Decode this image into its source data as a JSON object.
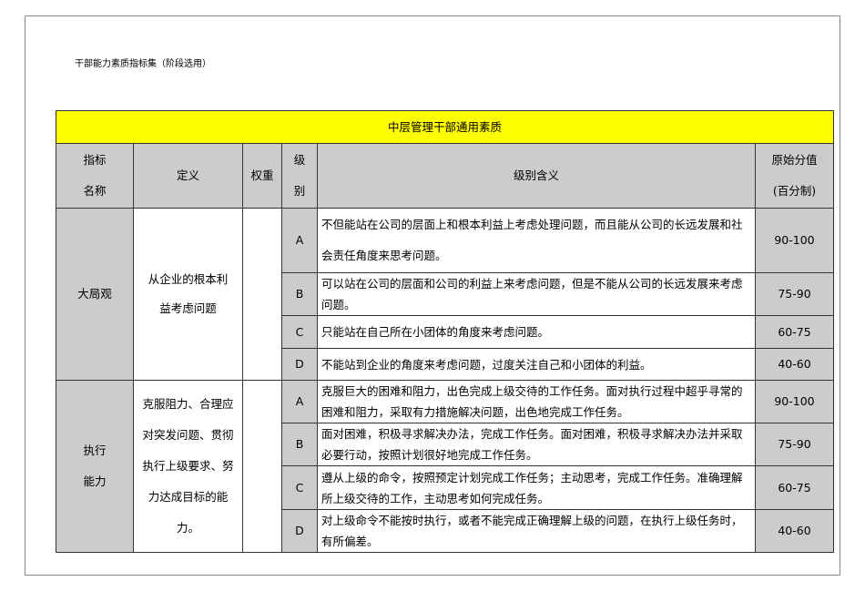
{
  "doc_title": "干部能力素质指标集（阶段选用）",
  "table_title": "中层管理干部通用素质",
  "headers": {
    "name_1": "指标",
    "name_2": "名称",
    "definition": "定义",
    "weight": "权重",
    "level_1": "级",
    "level_2": "别",
    "meaning": "级别含义",
    "score_1": "原始分值",
    "score_2": "(百分制)"
  },
  "groups": [
    {
      "name": "大局观",
      "definition": "从企业的根本利益考虑问题",
      "weight": "",
      "levels": [
        {
          "level": "A",
          "meaning": "不但能站在公司的层面上和根本利益上考虑处理问题，而且能从公司的长远发展和社会责任角度来思考问题。",
          "score": "90-100"
        },
        {
          "level": "B",
          "meaning": "可以站在公司的层面和公司的利益上来考虑问题，但是不能从公司的长远发展来考虑问题。",
          "score": "75-90"
        },
        {
          "level": "C",
          "meaning": "只能站在自己所在小团体的角度来考虑问题。",
          "score": "60-75"
        },
        {
          "level": "D",
          "meaning": "不能站到企业的角度来考虑问题，过度关注自己和小团体的利益。",
          "score": "40-60"
        }
      ]
    },
    {
      "name": "执行能力",
      "definition": "克服阻力、合理应对突发问题、贯彻执行上级要求、努力达成目标的能力。",
      "weight": "",
      "levels": [
        {
          "level": "A",
          "meaning": "克服巨大的困难和阻力，出色完成上级交待的工作任务。面对执行过程中超乎寻常的困难和阻力，采取有力措施解决问题，出色地完成工作任务。",
          "score": "90-100"
        },
        {
          "level": "B",
          "meaning": "面对困难，积极寻求解决办法，完成工作任务。面对困难，积极寻求解决办法并采取必要行动，按照计划很好地完成工作任务。",
          "score": "75-90"
        },
        {
          "level": "C",
          "meaning": "遵从上级的命令，按照预定计划完成工作任务；主动思考，完成工作任务。准确理解所上级交待的工作，主动思考如何完成任务。",
          "score": "60-75"
        },
        {
          "level": "D",
          "meaning": "对上级命令不能按时执行，或者不能完成正确理解上级的问题，在执行上级任务时，有所偏差。",
          "score": "40-60"
        }
      ]
    }
  ]
}
